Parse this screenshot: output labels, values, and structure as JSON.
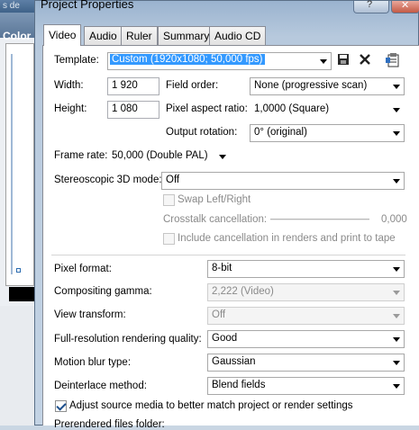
{
  "background_window": {
    "title_partial": "s de",
    "color_label": "Color"
  },
  "dialog": {
    "title": "Project Properties",
    "help_glyph": "?",
    "close_glyph": "✕"
  },
  "tabs": [
    {
      "label": "Video",
      "active": true
    },
    {
      "label": "Audio",
      "active": false
    },
    {
      "label": "Ruler",
      "active": false
    },
    {
      "label": "Summary",
      "active": false
    },
    {
      "label": "Audio CD",
      "active": false
    }
  ],
  "video": {
    "template_label": "Template:",
    "template_value": "Custom (1920x1080; 50,000 fps)",
    "width_label": "Width:",
    "width_value": "1 920",
    "height_label": "Height:",
    "height_value": "1 080",
    "field_order_label": "Field order:",
    "field_order_value": "None (progressive scan)",
    "pixel_aspect_label": "Pixel aspect ratio:",
    "pixel_aspect_value": "1,0000 (Square)",
    "output_rotation_label": "Output rotation:",
    "output_rotation_value": "0° (original)",
    "frame_rate_label": "Frame rate:",
    "frame_rate_value": "50,000 (Double PAL)",
    "stereo_label": "Stereoscopic 3D mode:",
    "stereo_value": "Off",
    "swap_label": "Swap Left/Right",
    "crosstalk_label": "Crosstalk cancellation:",
    "crosstalk_value": "0,000",
    "include_cancel_label": "Include cancellation in renders and print to tape",
    "pixel_format_label": "Pixel format:",
    "pixel_format_value": "8-bit",
    "compositing_gamma_label": "Compositing gamma:",
    "compositing_gamma_value": "2,222 (Video)",
    "view_transform_label": "View transform:",
    "view_transform_value": "Off",
    "full_res_label": "Full-resolution rendering quality:",
    "full_res_value": "Good",
    "motion_blur_label": "Motion blur type:",
    "motion_blur_value": "Gaussian",
    "deinterlace_label": "Deinterlace method:",
    "deinterlace_value": "Blend fields",
    "adjust_source_label": "Adjust source media to better match project or render settings",
    "adjust_source_checked": true,
    "prerendered_label": "Prerendered files folder:"
  }
}
